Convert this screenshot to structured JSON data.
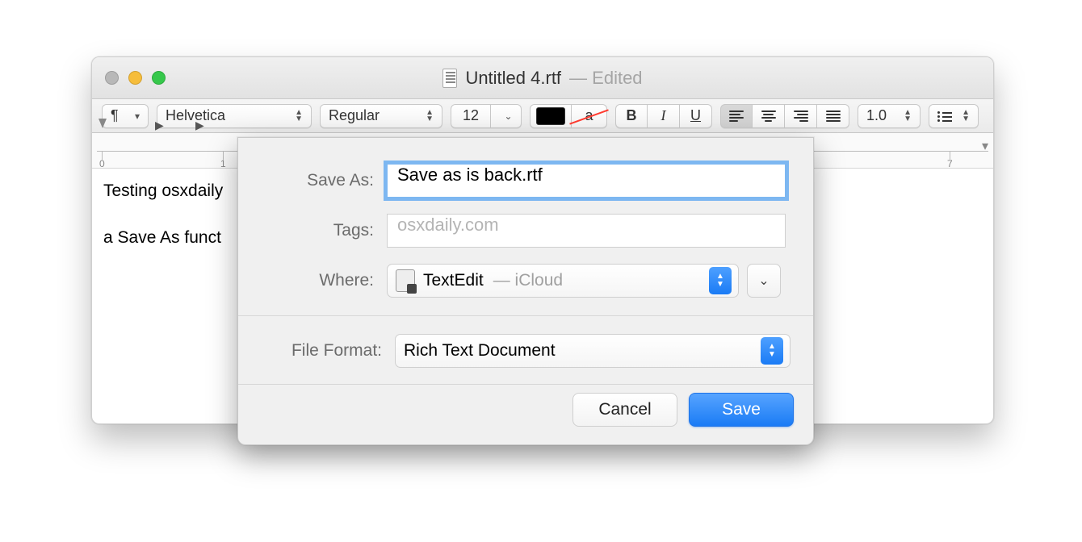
{
  "window": {
    "title": "Untitled 4.rtf",
    "status": "— Edited"
  },
  "toolbar": {
    "paragraph": "¶",
    "font": "Helvetica",
    "style": "Regular",
    "size": "12",
    "strike_char": "a",
    "bold": "B",
    "italic": "I",
    "underline": "U",
    "spacing": "1.0"
  },
  "ruler": {
    "labels": [
      "0",
      "1",
      "7"
    ]
  },
  "editor": {
    "line1": "Testing osxdaily",
    "line2": "a Save As funct"
  },
  "dialog": {
    "save_as_label": "Save As:",
    "save_as_value": "Save as is back.rtf",
    "tags_label": "Tags:",
    "tags_placeholder": "osxdaily.com",
    "where_label": "Where:",
    "where_app": "TextEdit",
    "where_loc": "— iCloud",
    "format_label": "File Format:",
    "format_value": "Rich Text Document",
    "cancel": "Cancel",
    "save": "Save"
  }
}
